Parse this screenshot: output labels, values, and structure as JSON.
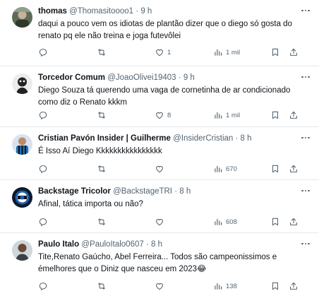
{
  "tweets": [
    {
      "name": "thomas",
      "handle": "@Thomasitoooo1",
      "separator": "·",
      "time": "9 h",
      "text": "daqui a pouco vem os idiotas de plantão dizer que o diego só gosta do\nrenato pq ele não treina e joga futevôlei",
      "likes": "1",
      "views": "1 mil",
      "replies": "",
      "retweets": ""
    },
    {
      "name": "Torcedor Comum",
      "handle": "@JoaoOlivei19403",
      "separator": "·",
      "time": "9 h",
      "text": "Diego Souza tá querendo uma vaga de cornetinha de ar condicionado\ncomo diz o Renato kkkm",
      "likes": "8",
      "views": "1 mil",
      "replies": "",
      "retweets": ""
    },
    {
      "name": "Cristian Pavón Insider | Guilherme",
      "handle": "@InsiderCristian",
      "separator": "·",
      "time": "8 h",
      "text": "É Isso Aí Diego Kkkkkkkkkkkkkkkk",
      "likes": "",
      "views": "670",
      "replies": "",
      "retweets": ""
    },
    {
      "name": "Backstage Tricolor",
      "handle": "@BackstageTRI",
      "separator": "·",
      "time": "8 h",
      "text": "Afinal, tática importa ou não?",
      "likes": "",
      "views": "608",
      "replies": "",
      "retweets": ""
    },
    {
      "name": "Paulo Italo",
      "handle": "@PauloItalo0607",
      "separator": "·",
      "time": "8 h",
      "text": "Tite,Renato Gaúcho, Abel Ferreira... Todos são campeonissimos e\némelhores que o Diniz que nasceu em 2023😂",
      "likes": "",
      "views": "138",
      "replies": "",
      "retweets": ""
    }
  ],
  "icons": {
    "reply": "reply-icon",
    "retweet": "retweet-icon",
    "like": "like-icon",
    "views": "views-icon",
    "bookmark": "bookmark-icon",
    "share": "share-icon",
    "more": "more-icon"
  },
  "colors": {
    "text": "#0f1419",
    "secondary": "#536471",
    "divider": "#e7e9ea"
  }
}
